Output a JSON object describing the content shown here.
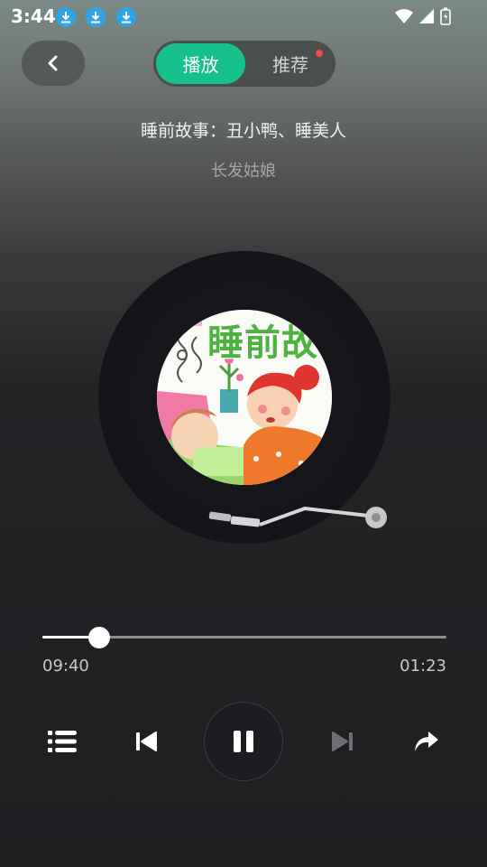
{
  "status_bar": {
    "time": "3:44",
    "download_icons": [
      "download-icon",
      "download-icon",
      "download-icon"
    ],
    "right_icons": [
      "wifi-icon",
      "signal-icon",
      "battery-icon"
    ]
  },
  "header": {
    "tabs": [
      {
        "label": "播放",
        "active": true
      },
      {
        "label": "推荐",
        "active": false,
        "has_badge_dot": true
      }
    ],
    "accent_color": "#17c18c"
  },
  "track": {
    "title": "睡前故事：丑小鸭、睡美人",
    "artist": "长发姑娘",
    "cover_text": "睡前故事"
  },
  "progress": {
    "elapsed": "09:40",
    "total": "01:23",
    "fraction": 0.14
  },
  "controls": [
    "playlist-icon",
    "previous-icon",
    "pause-icon",
    "next-icon",
    "share-icon"
  ]
}
